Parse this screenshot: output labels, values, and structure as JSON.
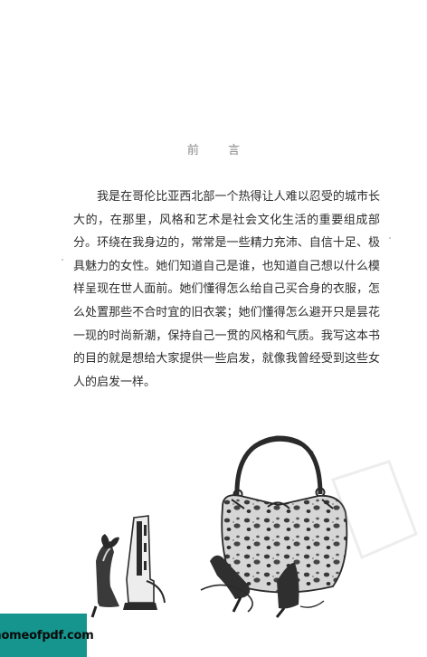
{
  "heading": "前 言",
  "paragraph": "我是在哥伦比亚西北部一个热得让人难以忍受的城市长大的，在那里，风格和艺术是社会文化生活的重要组成部分。环绕在我身边的，常常是一些精力充沛、自信十足、极具魅力的女性。她们知道自己是谁，也知道自己想以什么模样呈现在世人面前。她们懂得怎么给自己买合身的衣服，怎么处置那些不合时宜的旧衣裳；她们懂得怎么避开只是昙花一现的时尚新潮，保持自己一贯的风格和气质。我写这本书的目的就是想给大家提供一些启发，就像我曾经受到这些女人的启发一样。",
  "watermark": "homeofpdf.com",
  "colors": {
    "badge": "#15958e",
    "leopard_base": "#d8d8d8",
    "leopard_spot": "#3a3a3a"
  }
}
